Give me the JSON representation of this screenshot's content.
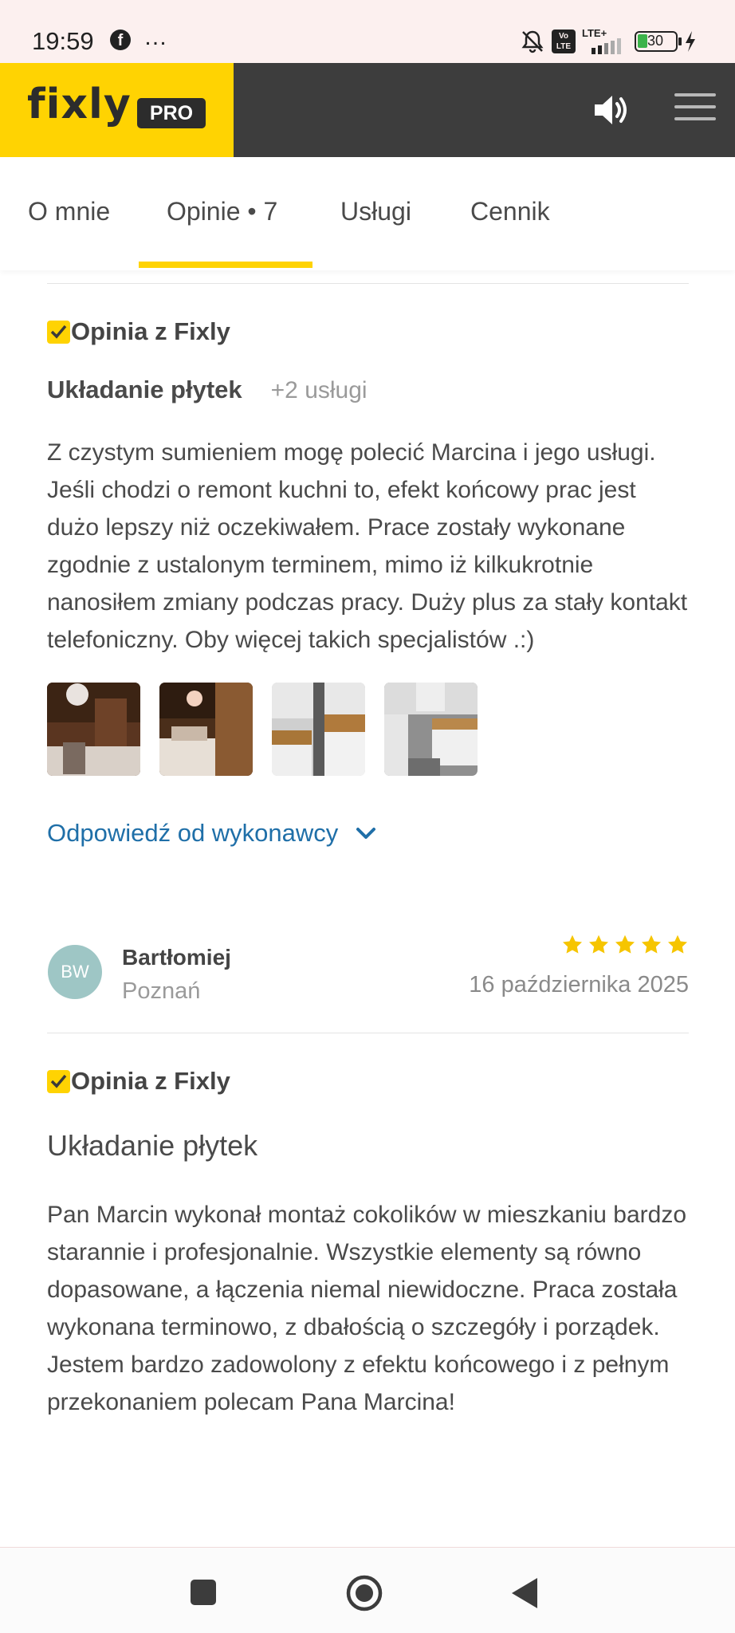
{
  "status": {
    "time": "19:59",
    "fb_glyph": "f",
    "dots": "…",
    "lte": "LTE+",
    "volte": "Vo LTE",
    "battery": "30"
  },
  "header": {
    "logo": "fixly",
    "pro_badge": "PRO"
  },
  "tabs": [
    {
      "label": "O mnie"
    },
    {
      "label": "Opinie • 7"
    },
    {
      "label": "Usługi"
    },
    {
      "label": "Cennik"
    }
  ],
  "review1": {
    "badge": "Opinia z Fixly",
    "service": "Układanie płytek",
    "more_services": "+2 usługi",
    "text": "Z czystym sumieniem mogę polecić Marcina i jego usługi. Jeśli chodzi o remont kuchni to, efekt końcowy prac jest dużo lepszy niż oczekiwałem. Prace zostały wykonane zgodnie z ustalonym terminem, mimo iż kilkukrotnie nanosiłem zmiany podczas pracy. Duży plus za stały kontakt telefoniczny. Oby więcej takich specjalistów .:)",
    "reply_link": "Odpowiedź od wykonawcy"
  },
  "review2": {
    "initials": "BW",
    "name": "Bartłomiej",
    "city": "Poznań",
    "rating": 5,
    "date": "16 października 2025",
    "badge": "Opinia z Fixly",
    "service": "Układanie płytek",
    "text": "Pan Marcin wykonał montaż cokolików w mieszkaniu bardzo starannie i profesjonalnie. Wszystkie elementy są równo dopasowane, a łączenia niemal niewidoczne. Praca została wykonana terminowo, z dbałością o szczegóły i porządek. Jestem bardzo zadowolony z efektu końcowego i z pełnym przekonaniem polecam Pana Marcina!"
  },
  "colors": {
    "brand_yellow": "#ffd302",
    "header_dark": "#3d3d3d",
    "link_blue": "#1f6fa8",
    "star": "#f6c500"
  }
}
